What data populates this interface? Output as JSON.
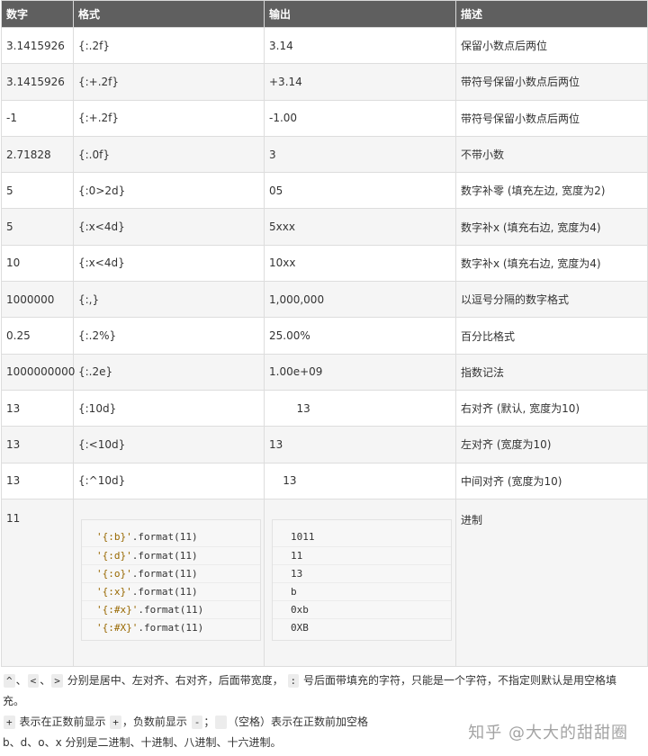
{
  "headers": [
    "数字",
    "格式",
    "输出",
    "描述"
  ],
  "rows": [
    [
      "3.1415926",
      "{:.2f}",
      "3.14",
      "保留小数点后两位"
    ],
    [
      "3.1415926",
      "{:+.2f}",
      "+3.14",
      "带符号保留小数点后两位"
    ],
    [
      "-1",
      "{:+.2f}",
      "-1.00",
      "带符号保留小数点后两位"
    ],
    [
      "2.71828",
      "{:.0f}",
      "3",
      "不带小数"
    ],
    [
      "5",
      "{:0>2d}",
      "05",
      "数字补零 (填充左边, 宽度为2)"
    ],
    [
      "5",
      "{:x<4d}",
      "5xxx",
      "数字补x (填充右边, 宽度为4)"
    ],
    [
      "10",
      "{:x<4d}",
      "10xx",
      "数字补x (填充右边, 宽度为4)"
    ],
    [
      "1000000",
      "{:,}",
      "1,000,000",
      "以逗号分隔的数字格式"
    ],
    [
      "0.25",
      "{:.2%}",
      "25.00%",
      "百分比格式"
    ],
    [
      "1000000000",
      "{:.2e}",
      "1.00e+09",
      "指数记法"
    ],
    [
      "13",
      "{:10d}",
      "        13",
      "右对齐 (默认, 宽度为10)"
    ],
    [
      "13",
      "{:<10d}",
      "13",
      "左对齐 (宽度为10)"
    ],
    [
      "13",
      "{:^10d}",
      "    13",
      "中间对齐 (宽度为10)"
    ]
  ],
  "last_row": {
    "number": "11",
    "description": "进制",
    "code_lines": [
      {
        "str": "'{:b}'",
        "rest": ".format(11)"
      },
      {
        "str": "'{:d}'",
        "rest": ".format(11)"
      },
      {
        "str": "'{:o}'",
        "rest": ".format(11)"
      },
      {
        "str": "'{:x}'",
        "rest": ".format(11)"
      },
      {
        "str": "'{:#x}'",
        "rest": ".format(11)"
      },
      {
        "str": "'{:#X}'",
        "rest": ".format(11)"
      }
    ],
    "outputs": [
      "1011",
      "11",
      "13",
      "b",
      "0xb",
      "0XB"
    ]
  },
  "notes": {
    "line1": {
      "k1": "^",
      "s1": "、",
      "k2": "<",
      "s2": "、",
      "k3": ">",
      "t1": " 分别是居中、左对齐、右对齐，后面带宽度， ",
      "k4": ":",
      "t2": " 号后面带填充的字符，只能是一个字符，不指定则默认是用空格填"
    },
    "line1b": "充。",
    "line2": {
      "k1": "+",
      "t1": " 表示在正数前显示 ",
      "k2": "+",
      "t2": "，负数前显示 ",
      "k3": "-",
      "t3": "；",
      "k4": " ",
      "t4": "（空格）表示在正数前加空格"
    },
    "line3": "b、d、o、x 分别是二进制、十进制、八进制、十六进制。"
  },
  "watermark": "知乎 @大大的甜甜圈"
}
